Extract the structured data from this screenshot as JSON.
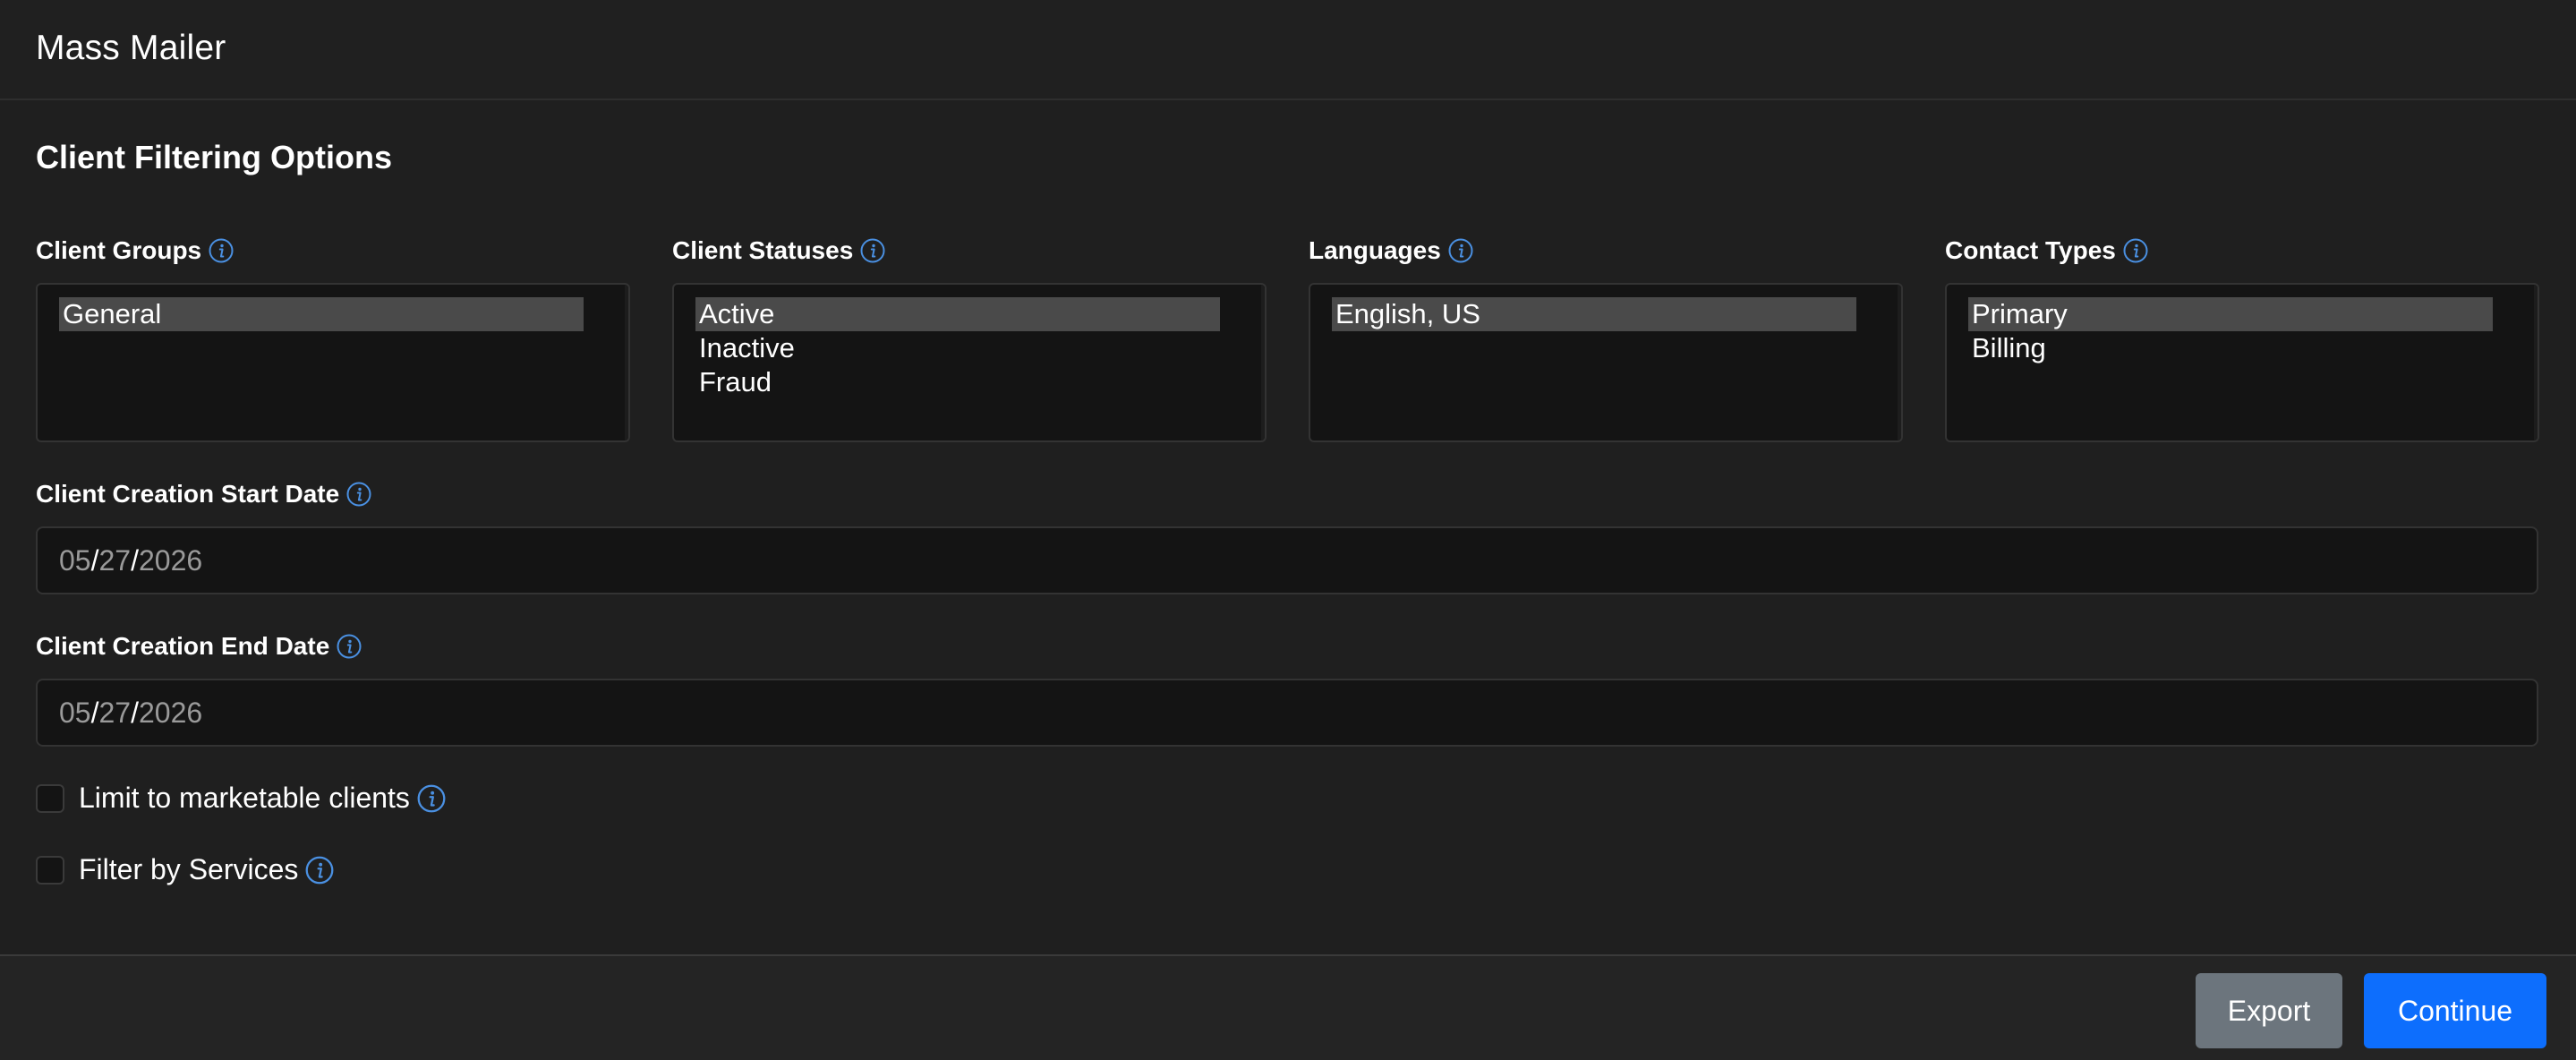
{
  "colors": {
    "background": "#1f1f1f",
    "input_bg": "#141414",
    "selected_option_bg": "#4a4a4a",
    "info_icon": "#4a90e2",
    "export_button": "#6c757d",
    "continue_button": "#0d6efd"
  },
  "header": {
    "title": "Mass Mailer"
  },
  "section": {
    "title": "Client Filtering Options"
  },
  "filters": {
    "client_groups": {
      "label": "Client Groups",
      "icon": "info-icon",
      "options": [
        {
          "label": "General",
          "selected": true
        }
      ]
    },
    "client_statuses": {
      "label": "Client Statuses",
      "icon": "info-icon",
      "options": [
        {
          "label": "Active",
          "selected": true
        },
        {
          "label": "Inactive",
          "selected": false
        },
        {
          "label": "Fraud",
          "selected": false
        }
      ]
    },
    "languages": {
      "label": "Languages",
      "icon": "info-icon",
      "options": [
        {
          "label": "English, US",
          "selected": true
        }
      ]
    },
    "contact_types": {
      "label": "Contact Types",
      "icon": "info-icon",
      "options": [
        {
          "label": "Primary",
          "selected": true
        },
        {
          "label": "Billing",
          "selected": false
        }
      ]
    }
  },
  "start_date": {
    "label": "Client Creation Start Date",
    "icon": "info-icon",
    "month": "05",
    "day": "27",
    "year": "2026",
    "separator": "/"
  },
  "end_date": {
    "label": "Client Creation End Date",
    "icon": "info-icon",
    "month": "05",
    "day": "27",
    "year": "2026",
    "separator": "/"
  },
  "options": {
    "marketable": {
      "label": "Limit to marketable clients",
      "checked": false,
      "icon": "info-icon"
    },
    "services": {
      "label": "Filter by Services",
      "checked": false,
      "icon": "info-icon"
    }
  },
  "footer": {
    "export_label": "Export",
    "continue_label": "Continue"
  }
}
